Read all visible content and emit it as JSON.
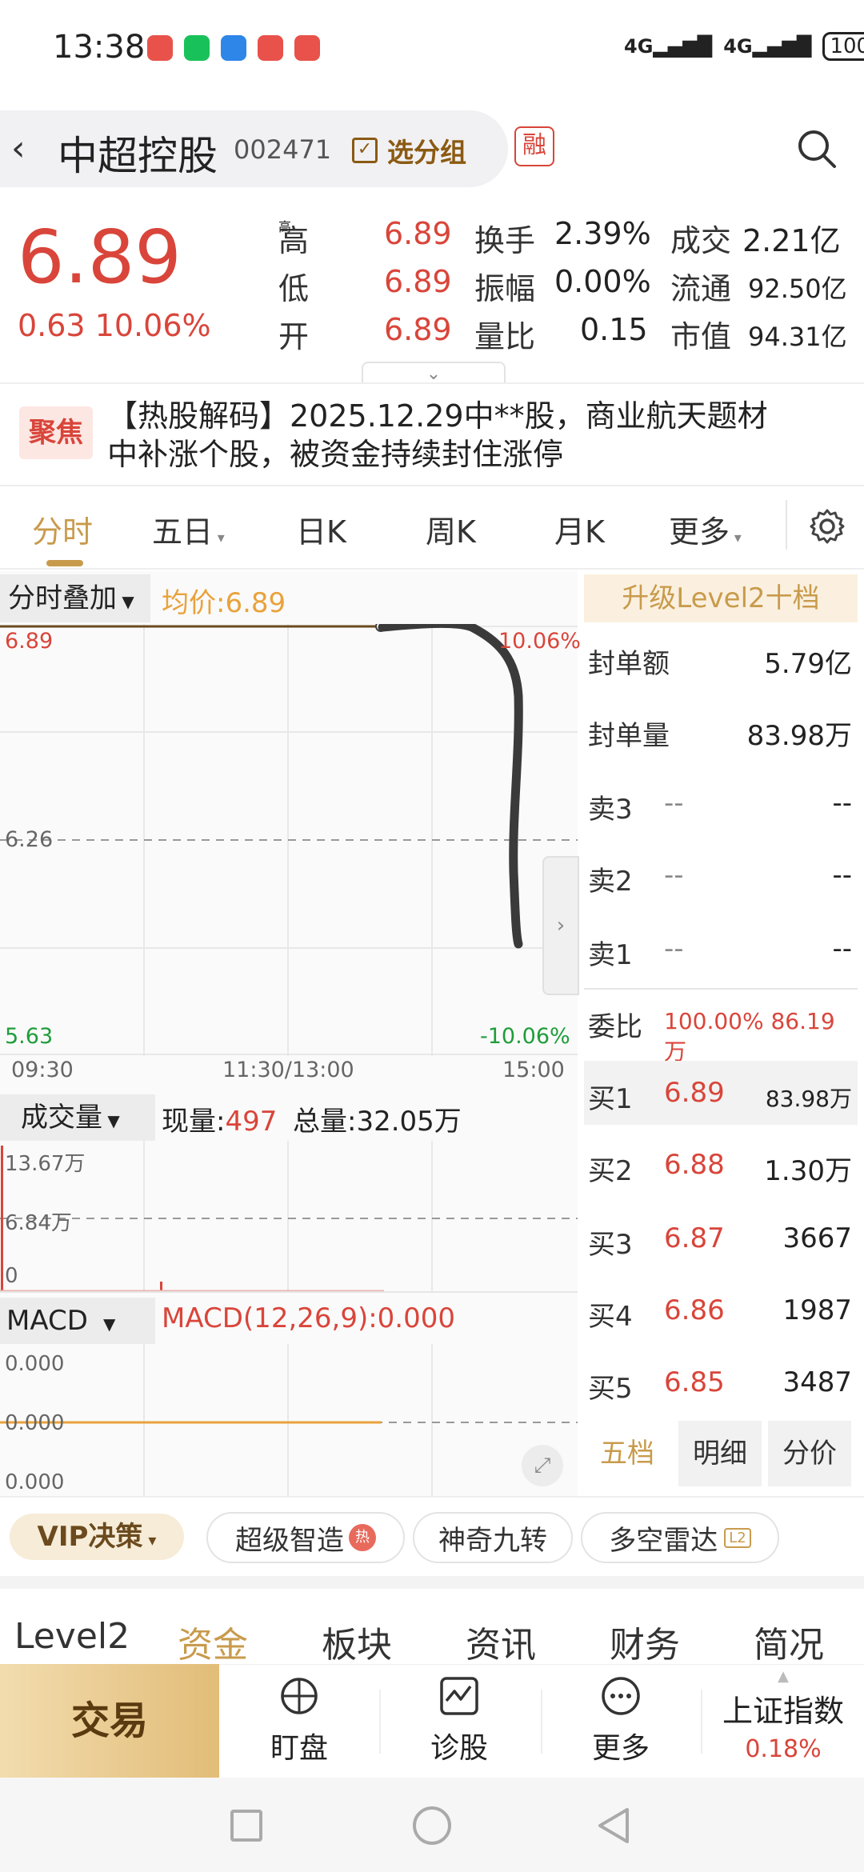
{
  "status_bar": {
    "time": "13:38",
    "signal1": "4G",
    "signal2": "4G",
    "battery": "100"
  },
  "header": {
    "title": "中超控股",
    "code": "002471",
    "add_group_label": "选分组",
    "margin_tag": "融"
  },
  "quote": {
    "price": "6.89",
    "change": "0.63",
    "change_pct": "10.06%",
    "rows": [
      {
        "l1": "高",
        "v1": "6.89",
        "l2": "换手",
        "v2": "2.39%",
        "l3": "成交",
        "v3": "2.21亿"
      },
      {
        "l1": "低",
        "v1": "6.89",
        "l2": "振幅",
        "v2": "0.00%",
        "l3": "流通",
        "v3": "92.50亿"
      },
      {
        "l1": "开",
        "v1": "6.89",
        "l2": "量比",
        "v2": "0.15",
        "l3": "市值",
        "v3": "94.31亿"
      }
    ]
  },
  "news": {
    "badge": "聚焦",
    "line1": "【热股解码】2025.12.29中**股，商业航天题材",
    "line2": "中补涨个股，被资金持续封住涨停"
  },
  "chart_tabs": [
    "分时",
    "五日",
    "日K",
    "周K",
    "月K",
    "更多"
  ],
  "intraday": {
    "overlay_label": "分时叠加",
    "avg_label": "均价:6.89",
    "y_top": "6.89",
    "y_mid": "6.26",
    "y_bot": "5.63",
    "pct_top": "10.06%",
    "pct_bot": "-10.06%",
    "x_start": "09:30",
    "x_mid": "11:30/13:00",
    "x_end": "15:00"
  },
  "volume": {
    "label": "成交量",
    "current_label": "现量:",
    "current": "497",
    "total_label": "总量:",
    "total": "32.05万",
    "y_top": "13.67万",
    "y_mid": "6.84万",
    "y_bot": "0"
  },
  "macd": {
    "label": "MACD",
    "params": "MACD(12,26,9):0.000",
    "y1": "0.000",
    "y2": "0.000",
    "y3": "0.000"
  },
  "level2": {
    "upgrade": "升级Level2十档",
    "seal_amount_label": "封单额",
    "seal_amount": "5.79亿",
    "seal_volume_label": "封单量",
    "seal_volume": "83.98万",
    "sells": [
      {
        "label": "卖3",
        "price": "--",
        "vol": "--"
      },
      {
        "label": "卖2",
        "price": "--",
        "vol": "--"
      },
      {
        "label": "卖1",
        "price": "--",
        "vol": "--"
      }
    ],
    "ratio_label": "委比",
    "ratio": "100.00% 86.19万",
    "buys": [
      {
        "label": "买1",
        "price": "6.89",
        "vol": "83.98万"
      },
      {
        "label": "买2",
        "price": "6.88",
        "vol": "1.30万"
      },
      {
        "label": "买3",
        "price": "6.87",
        "vol": "3667"
      },
      {
        "label": "买4",
        "price": "6.86",
        "vol": "1987"
      },
      {
        "label": "买5",
        "price": "6.85",
        "vol": "3487"
      }
    ],
    "sub_tabs": [
      "五档",
      "明细",
      "分价"
    ]
  },
  "tools": {
    "vip": "VIP决策",
    "chips": [
      "超级智造",
      "神奇九转",
      "多空雷达"
    ],
    "hot_badge": "热",
    "chip_badge": "L2"
  },
  "bottom_tabs": [
    "Level2",
    "资金",
    "板块",
    "资讯",
    "财务",
    "简况"
  ],
  "nav": {
    "trade": "交易",
    "items": [
      "盯盘",
      "诊股",
      "更多"
    ],
    "index_name": "上证指数",
    "index_pct": "0.18%"
  },
  "colors": {
    "up": "#d9453a",
    "down": "#1f9d3a",
    "gold": "#c89b4c",
    "avg_line": "#e9a23b"
  }
}
